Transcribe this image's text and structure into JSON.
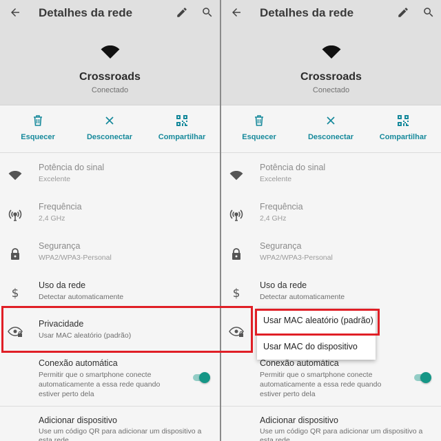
{
  "colors": {
    "accent": "#16899b",
    "toggle": "#159686",
    "highlight": "#e01f26"
  },
  "header": {
    "title": "Detalhes da rede",
    "icons": [
      "arrow-back-icon",
      "pencil-icon",
      "search-icon"
    ]
  },
  "network": {
    "name": "Crossroads",
    "status": "Conectado"
  },
  "actions": [
    {
      "label": "Esquecer",
      "icon": "trash-icon"
    },
    {
      "label": "Desconectar",
      "icon": "close-icon"
    },
    {
      "label": "Compartilhar",
      "icon": "qr-code-icon"
    }
  ],
  "rows": [
    {
      "title": "Potência do sinal",
      "subtitle": "Excelente",
      "icon": "wifi-icon"
    },
    {
      "title": "Frequência",
      "subtitle": "2,4 GHz",
      "icon": "antenna-icon"
    },
    {
      "title": "Segurança",
      "subtitle": "WPA2/WPA3-Personal",
      "icon": "lock-icon"
    },
    {
      "title": "Uso da rede",
      "subtitle": "Detectar automaticamente",
      "icon": "dollar-icon"
    },
    {
      "title": "Privacidade",
      "subtitle": "Usar MAC aleatório (padrão)",
      "icon": "eye-lock-icon"
    }
  ],
  "auto_connect": {
    "title": "Conexão automática",
    "description": "Permitir que o smartphone conecte automaticamente a essa rede quando estiver perto dela",
    "enabled": true
  },
  "add_device": {
    "title": "Adicionar dispositivo",
    "description": "Use um código QR para adicionar um dispositivo a esta rede"
  },
  "privacy_menu": {
    "options": [
      "Usar MAC aleatório (padrão)",
      "Usar MAC do dispositivo"
    ],
    "selected": "Usar MAC aleatório (padrão)"
  }
}
